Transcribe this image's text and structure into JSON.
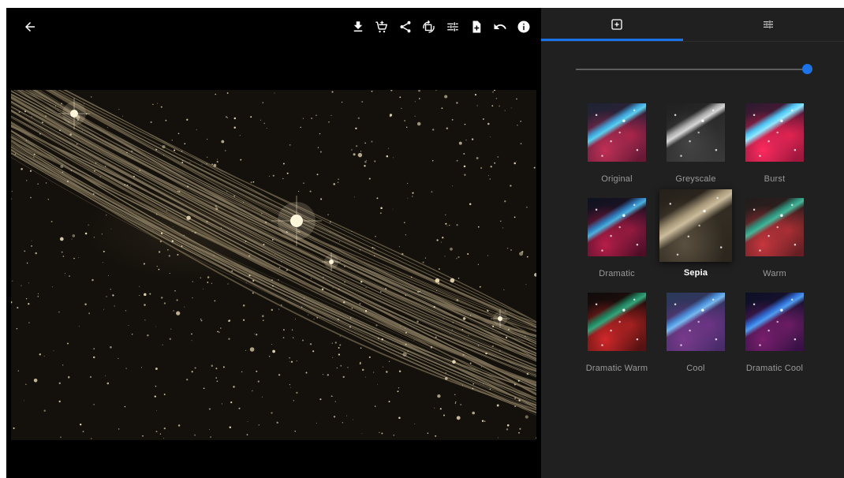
{
  "viewer": {
    "back_icon": "arrow-left-icon",
    "toolbar": [
      {
        "name": "download-button",
        "icon": "download-icon"
      },
      {
        "name": "buy-print-button",
        "icon": "cart-add-icon"
      },
      {
        "name": "share-button",
        "icon": "share-icon"
      },
      {
        "name": "rotate-button",
        "icon": "rotate-icon"
      },
      {
        "name": "adjust-button",
        "icon": "sliders-icon"
      },
      {
        "name": "save-copy-button",
        "icon": "file-add-icon"
      },
      {
        "name": "undo-button",
        "icon": "undo-icon"
      },
      {
        "name": "info-button",
        "icon": "info-icon"
      }
    ],
    "photo_tone": "sepia"
  },
  "panel": {
    "tabs": [
      {
        "name": "filters",
        "icon": "filter-add-icon",
        "active": true
      },
      {
        "name": "adjustments",
        "icon": "sliders-icon",
        "active": false
      }
    ],
    "intensity": 1.0,
    "filters": [
      {
        "label": "Original",
        "style": "t-original",
        "selected": false
      },
      {
        "label": "Greyscale",
        "style": "t-grey",
        "selected": false
      },
      {
        "label": "Burst",
        "style": "t-burst",
        "selected": false
      },
      {
        "label": "Dramatic",
        "style": "t-dramatic",
        "selected": false
      },
      {
        "label": "Sepia",
        "style": "t-sepia",
        "selected": true
      },
      {
        "label": "Warm",
        "style": "t-warm",
        "selected": false
      },
      {
        "label": "Dramatic Warm",
        "style": "t-dwarm",
        "selected": false
      },
      {
        "label": "Cool",
        "style": "t-cool",
        "selected": false
      },
      {
        "label": "Dramatic Cool",
        "style": "t-dcool",
        "selected": false
      }
    ]
  },
  "colors": {
    "accent": "#1a73e8",
    "panel_bg": "#202020",
    "viewer_bg": "#000000",
    "icon": "#ffffff",
    "sepia_light": "#e8d9b4"
  }
}
